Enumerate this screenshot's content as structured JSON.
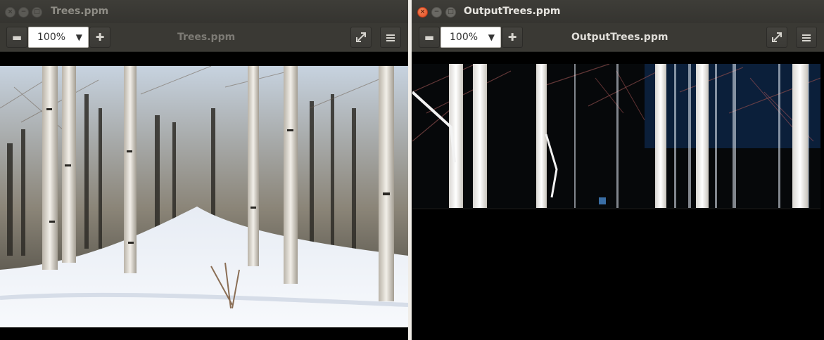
{
  "windows": {
    "left": {
      "title": "Trees.ppm",
      "doc_title": "Trees.ppm",
      "zoom": "100%",
      "image_name": "trees-forest-photo",
      "active": false
    },
    "right": {
      "title": "OutputTrees.ppm",
      "doc_title": "OutputTrees.ppm",
      "zoom": "100%",
      "image_name": "output-trees-photo",
      "active": true
    }
  },
  "icons": {
    "close": "close-icon",
    "minimize": "minimize-icon",
    "maximize": "maximize-icon",
    "zoom_out": "minus-icon",
    "zoom_in": "plus-icon",
    "dropdown": "chevron-down-icon",
    "fullscreen": "fullscreen-icon",
    "menu": "hamburger-menu-icon"
  },
  "colors": {
    "titlebar": "#3e3d38",
    "close_active": "#e2471f",
    "canvas_bg": "#000000"
  }
}
